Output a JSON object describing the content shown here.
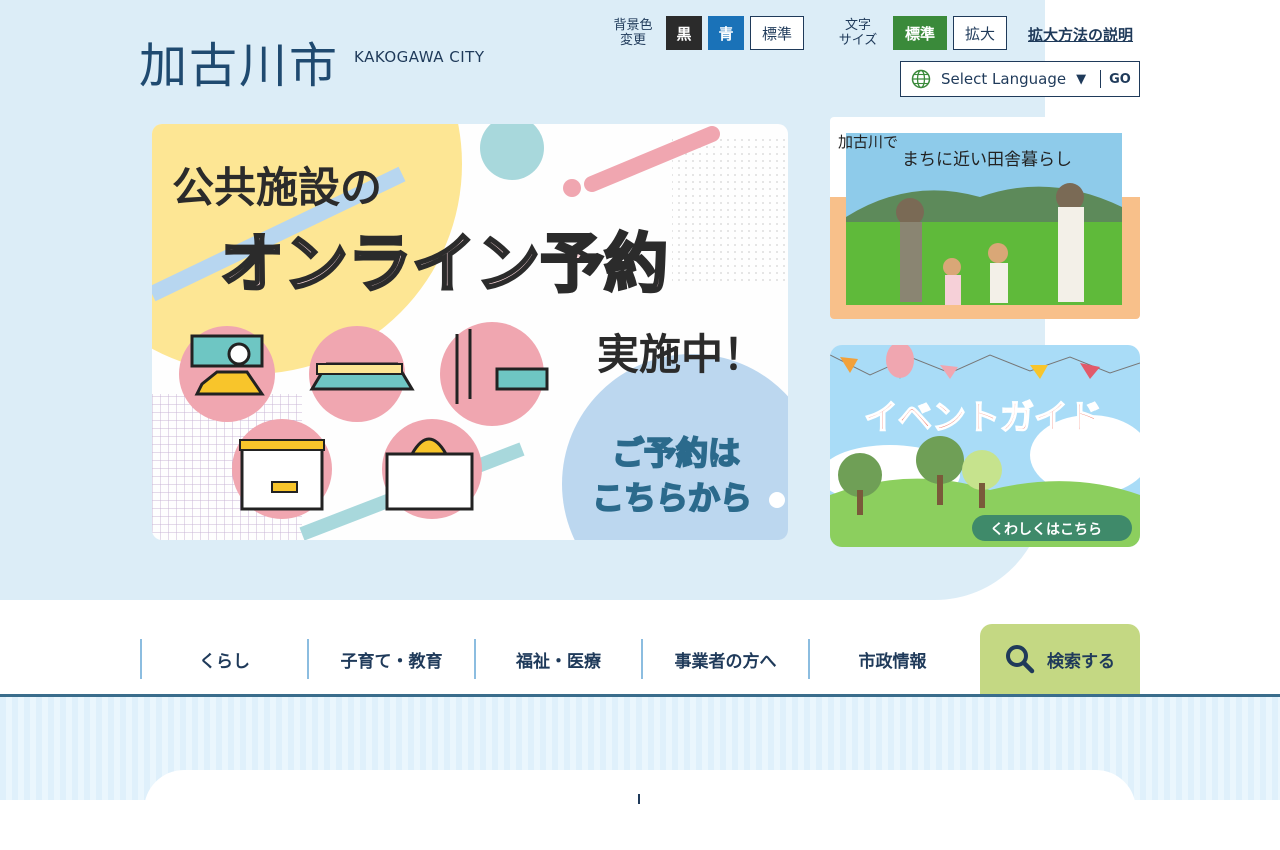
{
  "header": {
    "logo_jp": "加古川市",
    "logo_en": "KAKOGAWA CITY",
    "bg_label_line1": "背景色",
    "bg_label_line2": "変更",
    "bg_black": "黒",
    "bg_blue": "青",
    "bg_standard": "標準",
    "size_label_line1": "文字",
    "size_label_line2": "サイズ",
    "size_standard": "標準",
    "size_large": "拡大",
    "help_link": "拡大方法の説明",
    "language_select": "Select Language",
    "language_go": "GO"
  },
  "banners": {
    "main_title_1": "公共施設の",
    "main_title_2": "オンライン予約",
    "main_title_3": "実施中！",
    "main_cta_1": "ご予約は",
    "main_cta_2": "こちらから",
    "side1_text_1": "加古川で",
    "side1_text_2": "まちに近い田舎暮らし",
    "side2_title": "イベントガイド",
    "side2_cta": "くわしくはこちら"
  },
  "nav": {
    "items": [
      "くらし",
      "子育て・教育",
      "福祉・医療",
      "事業者の方へ",
      "市政情報"
    ],
    "search": "検索する"
  },
  "colors": {
    "brand_navy": "#1f3a5a",
    "hero_bg": "#dcedf7",
    "accent_green": "#3a8a3a",
    "accent_blue": "#1a72b8",
    "search_bg": "#c4d883"
  }
}
